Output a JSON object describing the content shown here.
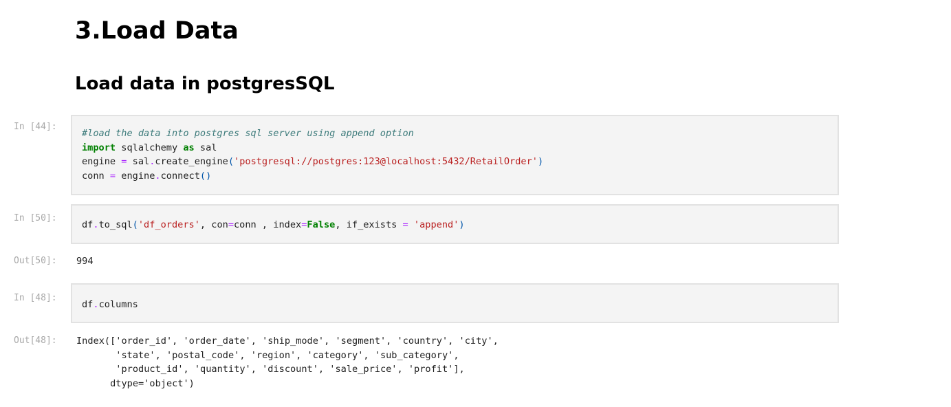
{
  "headings": {
    "h1": "3.Load Data",
    "h2": "Load data in postgresSQL"
  },
  "cells": [
    {
      "prompt": "In [44]:",
      "code": {
        "line1_comment": "#load the data into postgres sql server using append option",
        "line2_kw_import": "import",
        "line2_mod": " sqlalchemy ",
        "line2_kw_as": "as",
        "line2_alias": " sal",
        "line3_a": "engine ",
        "line3_eq": "=",
        "line3_b": " sal",
        "line3_dot": ".",
        "line3_c": "create_engine",
        "line3_po": "(",
        "line3_str": "'postgresql://postgres:123@localhost:5432/RetailOrder'",
        "line3_pc": ")",
        "line4_a": "conn ",
        "line4_eq": "=",
        "line4_b": " engine",
        "line4_dot": ".",
        "line4_c": "connect",
        "line4_p": "()"
      }
    },
    {
      "prompt": "In [50]:",
      "code": {
        "a": "df",
        "dot": ".",
        "fn": "to_sql",
        "po": "(",
        "s1": "'df_orders'",
        "c1": ", con",
        "eq1": "=",
        "c2": "conn , index",
        "eq2": "=",
        "kwfalse": "False",
        "c3": ", if_exists ",
        "eq3": "=",
        "sp": " ",
        "s2": "'append'",
        "pc": ")"
      },
      "out_prompt": "Out[50]:",
      "output": "994"
    },
    {
      "prompt": "In [48]:",
      "code": {
        "a": "df",
        "dot": ".",
        "b": "columns"
      },
      "out_prompt": "Out[48]:",
      "output": "Index(['order_id', 'order_date', 'ship_mode', 'segment', 'country', 'city',\n       'state', 'postal_code', 'region', 'category', 'sub_category',\n       'product_id', 'quantity', 'discount', 'sale_price', 'profit'],\n      dtype='object')"
    }
  ]
}
